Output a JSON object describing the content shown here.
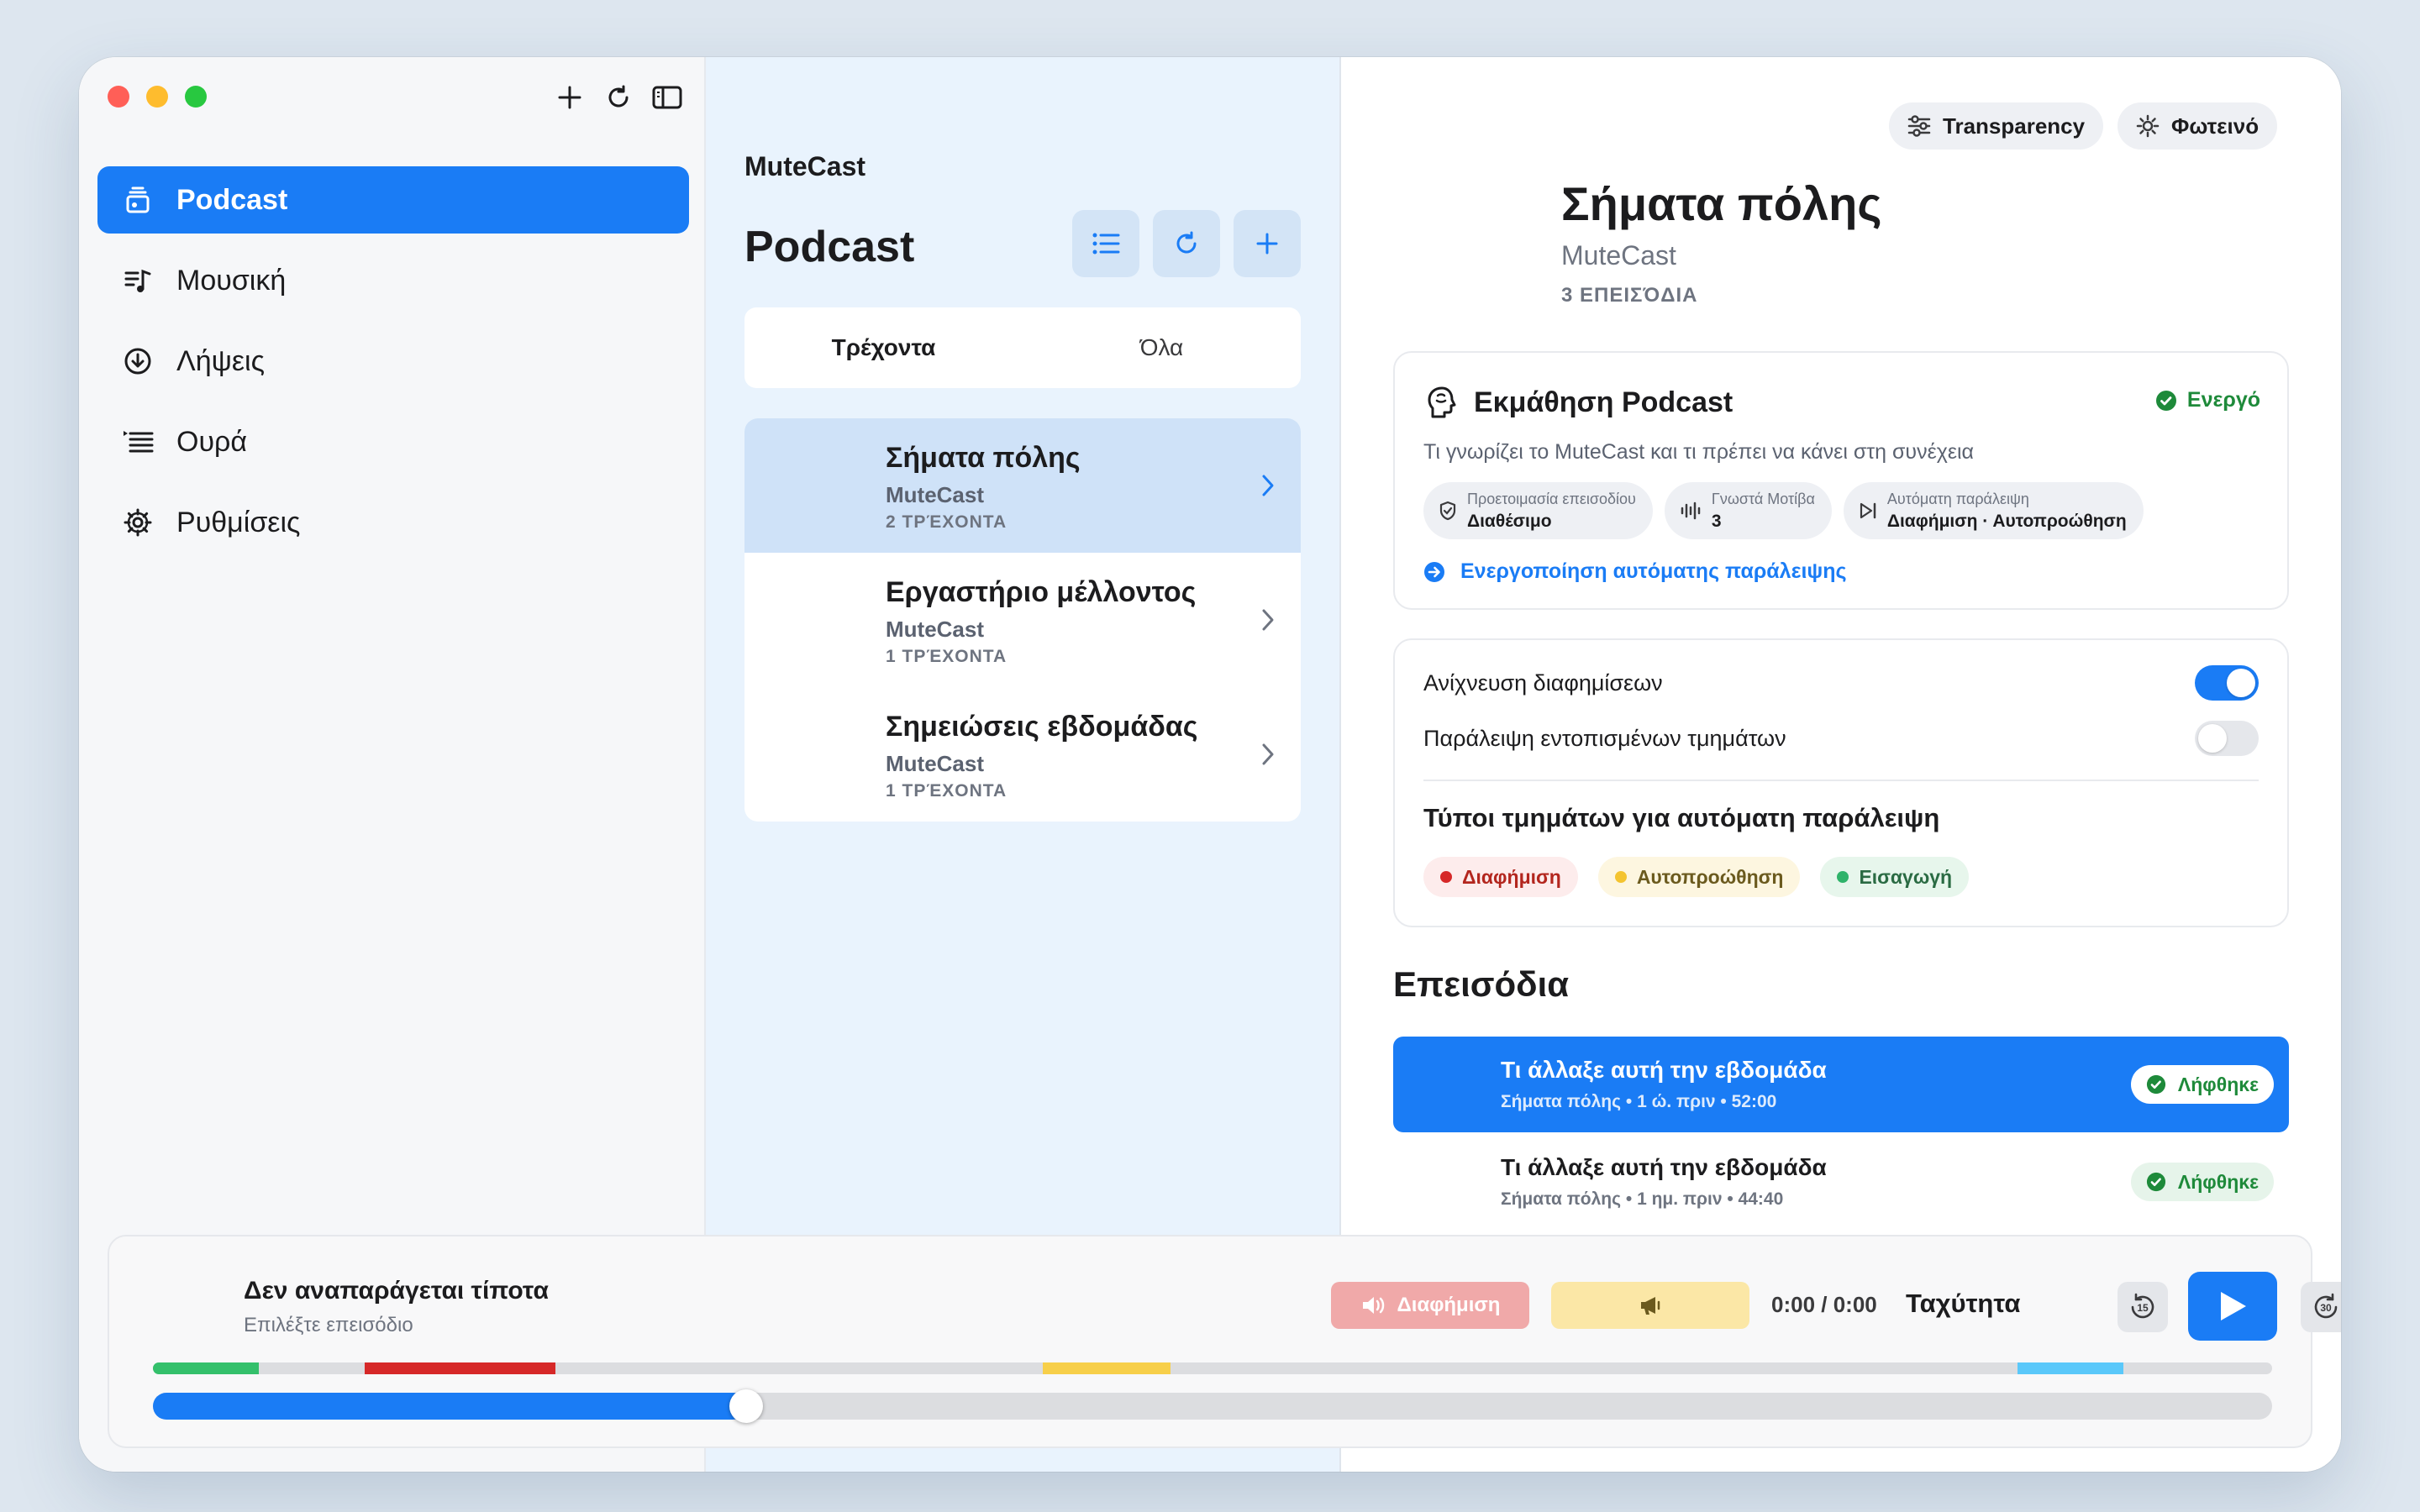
{
  "sidebar": {
    "items": [
      {
        "label": "Podcast",
        "icon": "podcast-stack-icon",
        "active": true
      },
      {
        "label": "Μουσική",
        "icon": "music-list-icon"
      },
      {
        "label": "Λήψεις",
        "icon": "download-circle-icon"
      },
      {
        "label": "Ουρά",
        "icon": "queue-list-icon"
      },
      {
        "label": "Ρυθμίσεις",
        "icon": "gear-icon"
      }
    ]
  },
  "middle": {
    "app_name": "MuteCast",
    "title": "Podcast",
    "segments": [
      "Τρέχοντα",
      "Όλα"
    ],
    "podcasts": [
      {
        "title": "Σήματα πόλης",
        "author": "MuteCast",
        "count": "2 ΤΡΈΧΟΝΤΑ",
        "selected": true
      },
      {
        "title": "Εργαστήριο μέλλοντος",
        "author": "MuteCast",
        "count": "1 ΤΡΈΧΟΝΤΑ"
      },
      {
        "title": "Σημειώσεις εβδομάδας",
        "author": "MuteCast",
        "count": "1 ΤΡΈΧΟΝΤΑ"
      }
    ]
  },
  "detail": {
    "transparency_label": "Transparency",
    "theme_label": "Φωτεινό",
    "title": "Σήματα πόλης",
    "author": "MuteCast",
    "episode_count": "3 ΕΠΕΙΣΌΔΙΑ",
    "learning": {
      "title": "Εκμάθηση Podcast",
      "status": "Ενεργό",
      "description": "Τι γνωρίζει το MuteCast και τι πρέπει να κάνει στη συνέχεια",
      "chips": [
        {
          "label": "Προετοιμασία επεισοδίου",
          "value": "Διαθέσιμο",
          "icon": "shield-check-icon"
        },
        {
          "label": "Γνωστά Μοτίβα",
          "value": "3",
          "icon": "waveform-icon"
        },
        {
          "label": "Αυτόματη παράλειψη",
          "value": "Διαφήμιση · Αυτοπροώθηση",
          "icon": "skip-forward-icon"
        }
      ],
      "link": "Ενεργοποίηση αυτόματης παράλειψης"
    },
    "settings": {
      "detect_ads_label": "Ανίχνευση διαφημίσεων",
      "detect_ads_on": true,
      "skip_detected_label": "Παράλειψη εντοπισμένων τμημάτων",
      "skip_detected_on": false,
      "types_title": "Τύποι τμημάτων για αυτόματη παράλειψη",
      "types": [
        {
          "label": "Διαφήμιση",
          "color": "#d62828",
          "bg": "#fdecec",
          "text": "#b3261e"
        },
        {
          "label": "Αυτοπροώθηση",
          "color": "#f4c430",
          "bg": "#fdf6e0",
          "text": "#6b5a1e"
        },
        {
          "label": "Εισαγωγή",
          "color": "#2fb36a",
          "bg": "#e7f6ec",
          "text": "#2a6b43"
        }
      ]
    },
    "episodes_heading": "Επεισόδια",
    "episodes": [
      {
        "title": "Τι άλλαξε αυτή την εβδομάδα",
        "meta": "Σήματα πόλης • 1 ώ. πριν • 52:00",
        "status": "Λήφθηκε",
        "selected": true
      },
      {
        "title": "Τι άλλαξε αυτή την εβδομάδα",
        "meta": "Σήματα πόλης • 1 ημ. πριν • 44:40",
        "status": "Λήφθηκε"
      }
    ]
  },
  "player": {
    "title": "Δεν αναπαράγεται τίποτα",
    "subtitle": "Επιλέξτε επεισόδιο",
    "ad_button": "Διαφήμιση",
    "time": "0:00 / 0:00",
    "speed_label": "Ταχύτητα",
    "skip_back": "15",
    "skip_forward": "30",
    "progress": 0.28,
    "segments": [
      {
        "start": 0.0,
        "end": 0.05,
        "color": "#34c06b"
      },
      {
        "start": 0.1,
        "end": 0.19,
        "color": "#d62828"
      },
      {
        "start": 0.42,
        "end": 0.48,
        "color": "#f7cf4a"
      },
      {
        "start": 0.88,
        "end": 0.93,
        "color": "#5ac8fa"
      }
    ]
  },
  "colors": {
    "accent": "#1a7cf5",
    "success": "#1e8a3a"
  }
}
